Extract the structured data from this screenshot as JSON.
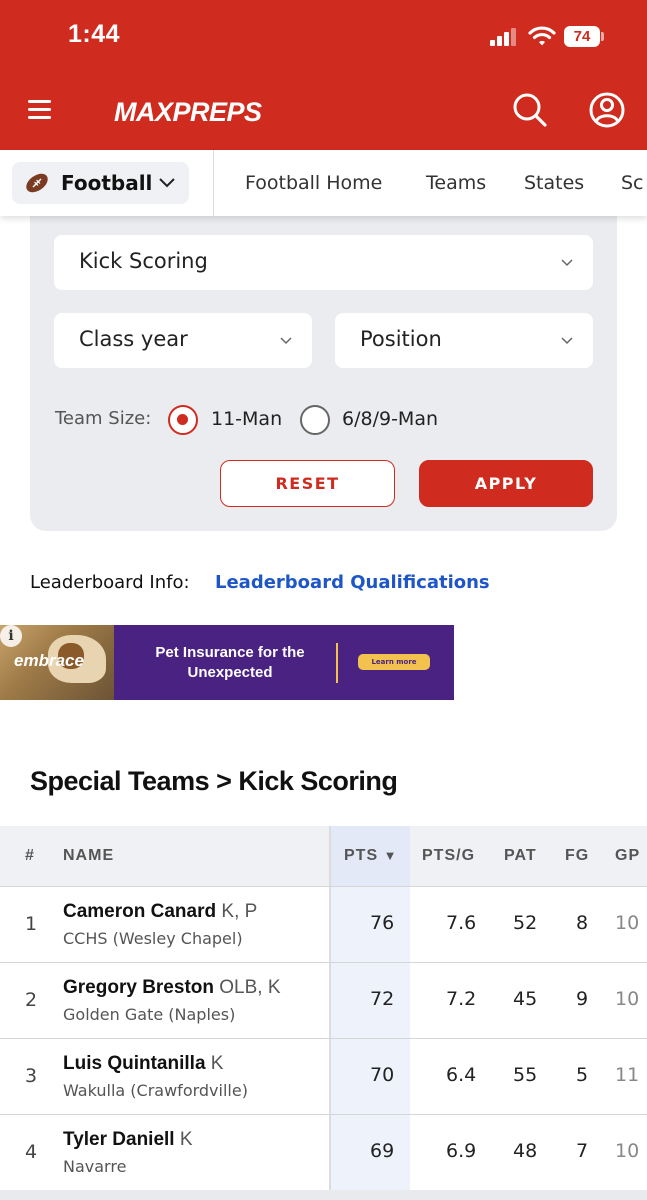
{
  "status_bar": {
    "time": "1:44",
    "battery": "74"
  },
  "header": {
    "logo": "MAXPREPS"
  },
  "sport_nav": {
    "sport": "Football",
    "links": [
      "Football Home",
      "Teams",
      "States",
      "Sc"
    ]
  },
  "filters": {
    "stat_category": "Kick Scoring",
    "class_year": "Class year",
    "position": "Position",
    "team_size_label": "Team Size:",
    "team_size_options": [
      "11-Man",
      "6/8/9-Man"
    ],
    "team_size_selected": "11-Man",
    "reset_label": "RESET",
    "apply_label": "APPLY"
  },
  "leaderboard_info": {
    "label": "Leaderboard Info:",
    "link": "Leaderboard Qualifications"
  },
  "ad": {
    "brand": "embrace",
    "text": "Pet Insurance for the Unexpected",
    "cta": "Learn more"
  },
  "section_title": "Special Teams > Kick Scoring",
  "table": {
    "headers": {
      "rank": "#",
      "name": "NAME",
      "pts": "PTS",
      "pts_g": "PTS/G",
      "pat": "PAT",
      "fg": "FG",
      "gp": "GP"
    },
    "rows": [
      {
        "rank": "1",
        "name": "Cameron Canard",
        "pos": "K, P",
        "school": "CCHS (Wesley Chapel)",
        "pts": "76",
        "pts_g": "7.6",
        "pat": "52",
        "fg": "8",
        "gp": "10"
      },
      {
        "rank": "2",
        "name": "Gregory Breston",
        "pos": "OLB, K",
        "school": "Golden Gate (Naples)",
        "pts": "72",
        "pts_g": "7.2",
        "pat": "45",
        "fg": "9",
        "gp": "10"
      },
      {
        "rank": "3",
        "name": "Luis Quintanilla",
        "pos": "K",
        "school": "Wakulla (Crawfordville)",
        "pts": "70",
        "pts_g": "6.4",
        "pat": "55",
        "fg": "5",
        "gp": "11"
      },
      {
        "rank": "4",
        "name": "Tyler Daniell",
        "pos": "K",
        "school": "Navarre",
        "pts": "69",
        "pts_g": "6.9",
        "pat": "48",
        "fg": "7",
        "gp": "10"
      }
    ]
  },
  "colors": {
    "brand_red": "#cf2b1f",
    "link_blue": "#1e56c8",
    "ad_purple": "#4a2382"
  }
}
